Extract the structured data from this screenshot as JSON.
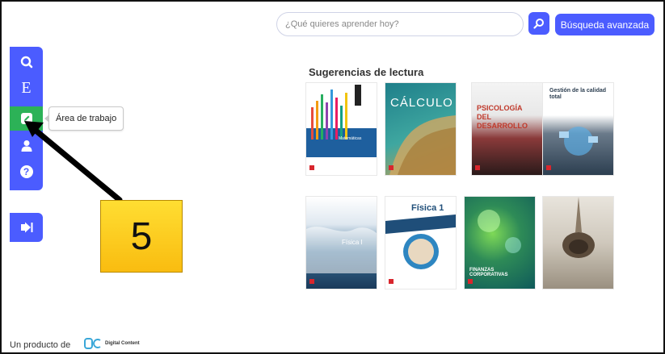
{
  "search": {
    "placeholder": "¿Qué quieres aprender hoy?",
    "advanced_label": "Búsqueda avanzada"
  },
  "sidebar": {
    "items": [
      {
        "icon": "search-icon"
      },
      {
        "icon": "letter-e-icon",
        "glyph": "E"
      },
      {
        "icon": "edit-icon",
        "active": true
      },
      {
        "icon": "user-icon"
      },
      {
        "icon": "help-icon",
        "glyph": "?"
      }
    ],
    "tooltip": "Área de trabajo",
    "logout_icon": "logout-icon"
  },
  "annotation": {
    "step": "5"
  },
  "suggestions": {
    "title": "Sugerencias de lectura",
    "books": [
      {
        "title": "Matemáticas"
      },
      {
        "title": "CÁLCULO"
      },
      {
        "title": "PSICOLOGÍA DEL DESARROLLO"
      },
      {
        "title": "Gestión de la calidad total"
      },
      {
        "title": "Física I"
      },
      {
        "title": "Física 1"
      },
      {
        "title": "FINANZAS CORPORATIVAS"
      },
      {
        "title": ""
      }
    ]
  },
  "footer": {
    "text": "Un producto de",
    "brand": "Digital Content"
  },
  "colors": {
    "primary": "#4b5cff",
    "active": "#2cb257",
    "badge": "#f9bc10"
  }
}
